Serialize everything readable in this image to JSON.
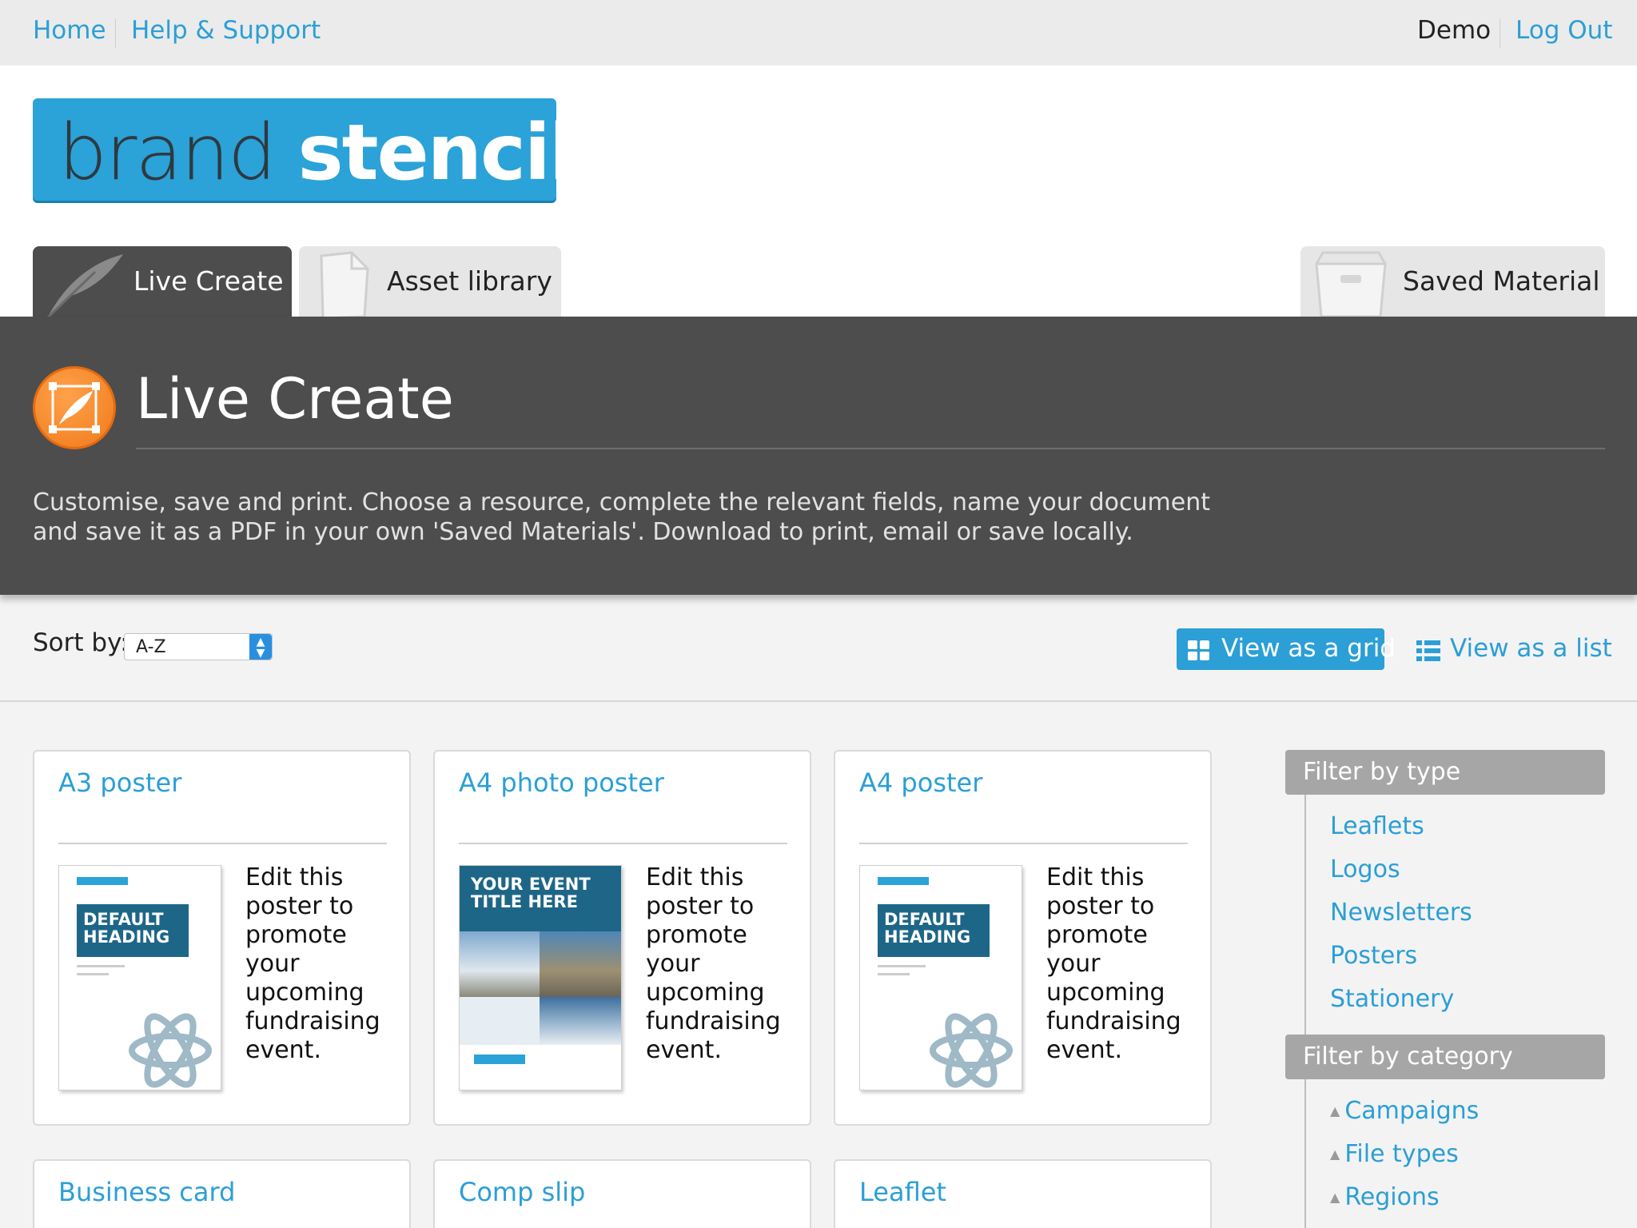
{
  "topbar": {
    "home": "Home",
    "help": "Help & Support",
    "user": "Demo",
    "logout": "Log Out"
  },
  "logo": {
    "part1": "brand",
    "part2": "stencil"
  },
  "tabs": [
    {
      "label": "Live Create",
      "active": true,
      "icon": "feather-icon"
    },
    {
      "label": "Asset library",
      "active": false,
      "icon": "document-icon"
    },
    {
      "label": "Saved Material",
      "active": false,
      "icon": "folder-icon"
    }
  ],
  "banner": {
    "title": "Live Create",
    "icon": "feather-icon",
    "description": "Customise, save and print. Choose a resource, complete the relevant fields, name your document and save it as a PDF in your own 'Saved Materials'. Download to print, email or save locally."
  },
  "toolbar": {
    "sort_label": "Sort by:",
    "sort_value": "A-Z",
    "grid_label": "View as a grid",
    "list_label": "View as a list"
  },
  "cards": [
    {
      "title": "A3 poster",
      "description": "Edit this poster to promote your upcoming fundraising event.",
      "thumb_heading": "DEFAULT HEADING"
    },
    {
      "title": "A4 photo poster",
      "description": "Edit this poster to promote your upcoming fundraising event.",
      "thumb_heading": "YOUR EVENT TITLE HERE"
    },
    {
      "title": "A4 poster",
      "description": "Edit this poster to promote your upcoming fundraising event.",
      "thumb_heading": "DEFAULT HEADING"
    },
    {
      "title": "Business card"
    },
    {
      "title": "Comp slip"
    },
    {
      "title": "Leaflet"
    }
  ],
  "filters": {
    "type_heading": "Filter by type",
    "types": [
      "Leaflets",
      "Logos",
      "Newsletters",
      "Posters",
      "Stationery"
    ],
    "category_heading": "Filter by category",
    "categories": [
      "Campaigns",
      "File types",
      "Regions"
    ]
  },
  "colors": {
    "accent": "#2b9fd6",
    "banner": "#4d4d4d",
    "icon_orange": "#f07a1a"
  }
}
